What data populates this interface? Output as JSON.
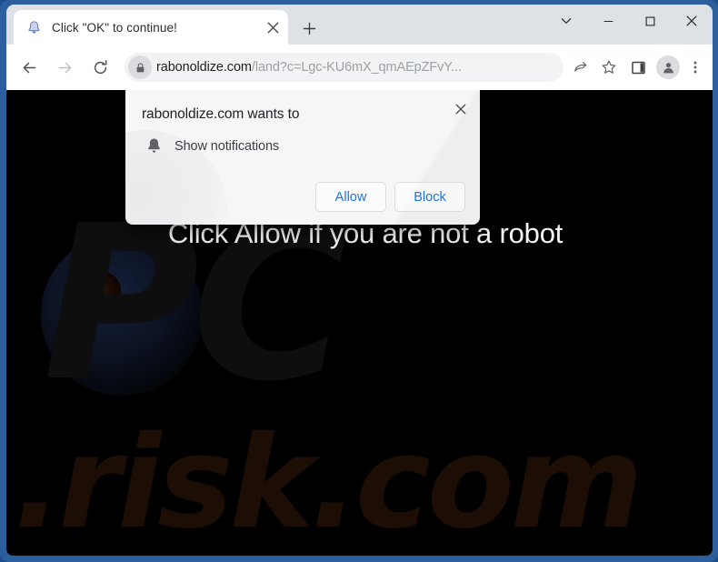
{
  "browser": {
    "tab": {
      "title": "Click \"OK\" to continue!",
      "favicon_icon": "bell-favicon-icon",
      "close_icon": "close-icon"
    },
    "new_tab_icon": "plus-icon",
    "window_controls": {
      "tab_search_icon": "chevron-down-icon",
      "minimize_icon": "minimize-icon",
      "maximize_icon": "maximize-icon",
      "close_icon": "close-icon"
    },
    "toolbar": {
      "back_icon": "arrow-left-icon",
      "forward_icon": "arrow-right-icon",
      "reload_icon": "reload-icon",
      "site_info_icon": "lock-icon",
      "url_host": "rabonoldize.com",
      "url_path": "/land?c=Lgc-KU6mX_qmAEpZFvY...",
      "share_icon": "share-icon",
      "bookmark_icon": "star-icon",
      "side_panel_icon": "side-panel-icon",
      "profile_icon": "person-icon",
      "menu_icon": "three-dot-menu-icon"
    }
  },
  "page": {
    "headline": "Click Allow if you are not a robot",
    "watermark_top": "PC",
    "watermark_bottom": ".risk.com",
    "background_color": "#000000"
  },
  "dialog": {
    "title": "rabonoldize.com wants to",
    "permission_icon": "bell-icon",
    "permission_label": "Show notifications",
    "allow_label": "Allow",
    "block_label": "Block",
    "close_icon": "close-icon",
    "button_text_color": "#1a73e8"
  }
}
